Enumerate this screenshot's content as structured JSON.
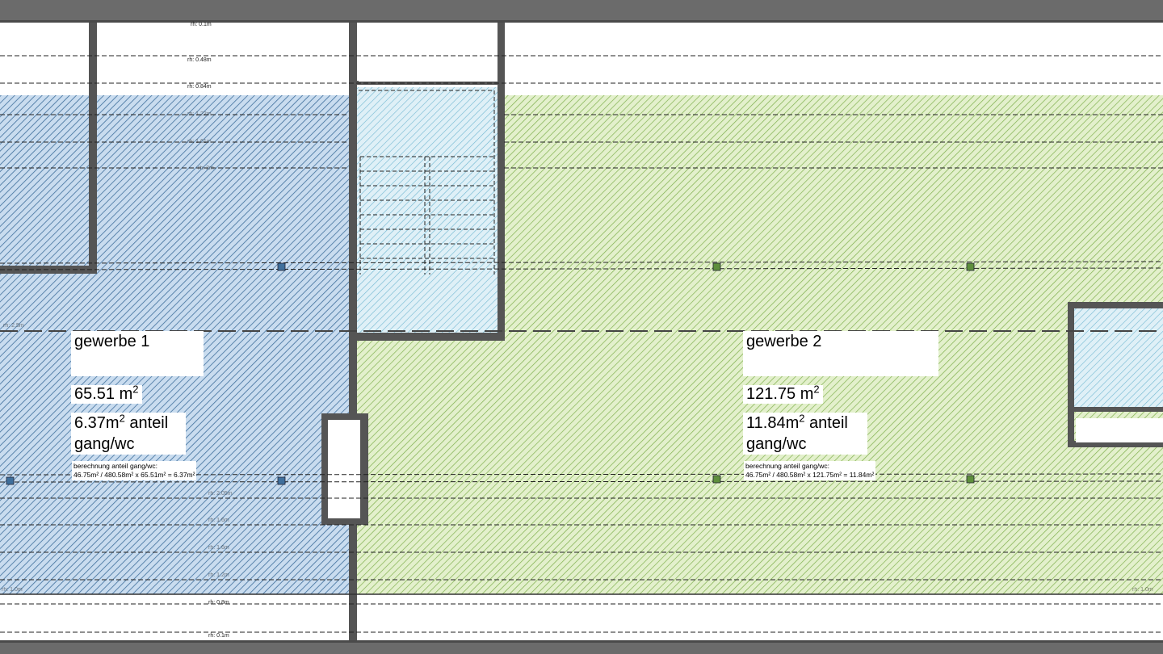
{
  "colors": {
    "frame": "#6b6b6b",
    "wall": "#555555",
    "paper": "#ffffff",
    "gewerbe1_fill": "#c9dcef",
    "gewerbe1_hatch": "#3f6f9c",
    "gewerbe2_fill": "#e3f0cc",
    "gewerbe2_hatch": "#7fb04e",
    "stair_fill": "#dff0f7",
    "stair_hatch": "#6fb6d0"
  },
  "rooms": [
    {
      "name": "gewerbe 1",
      "area": "65.51 m",
      "area_unit_sup": "2",
      "share_value": "6.37m",
      "share_sup": "2",
      "share_text": " anteil",
      "share_text2": "gang/wc",
      "calc_title": "berechnung anteil gang/wc:",
      "calc_formula": "46.75m² / 480.58m² x 65.51m² = 6.37m²"
    },
    {
      "name": "gewerbe 2",
      "area": "121.75 m",
      "area_unit_sup": "2",
      "share_value": "11.84m",
      "share_sup": "2",
      "share_text": " anteil",
      "share_text2": "gang/wc",
      "calc_title": "berechnung anteil gang/wc:",
      "calc_formula": "46.75m² / 480.58m² x 121.75m² = 11.84m²"
    }
  ],
  "rh_labels": [
    "rh: 0.1m",
    "rh: 0.48m",
    "rh: 0.84m",
    "rh: 1.22m",
    "rh: 1.61m",
    "rh: 2m",
    "rh: 2.5m",
    "rh: 2.05m",
    "rh: 1.6m",
    "rh: 1.6m",
    "rh: 1.2m",
    "rh: 1.0m",
    "rh: 0.8m",
    "rh: 0.1m",
    "rh: 1.0m"
  ]
}
